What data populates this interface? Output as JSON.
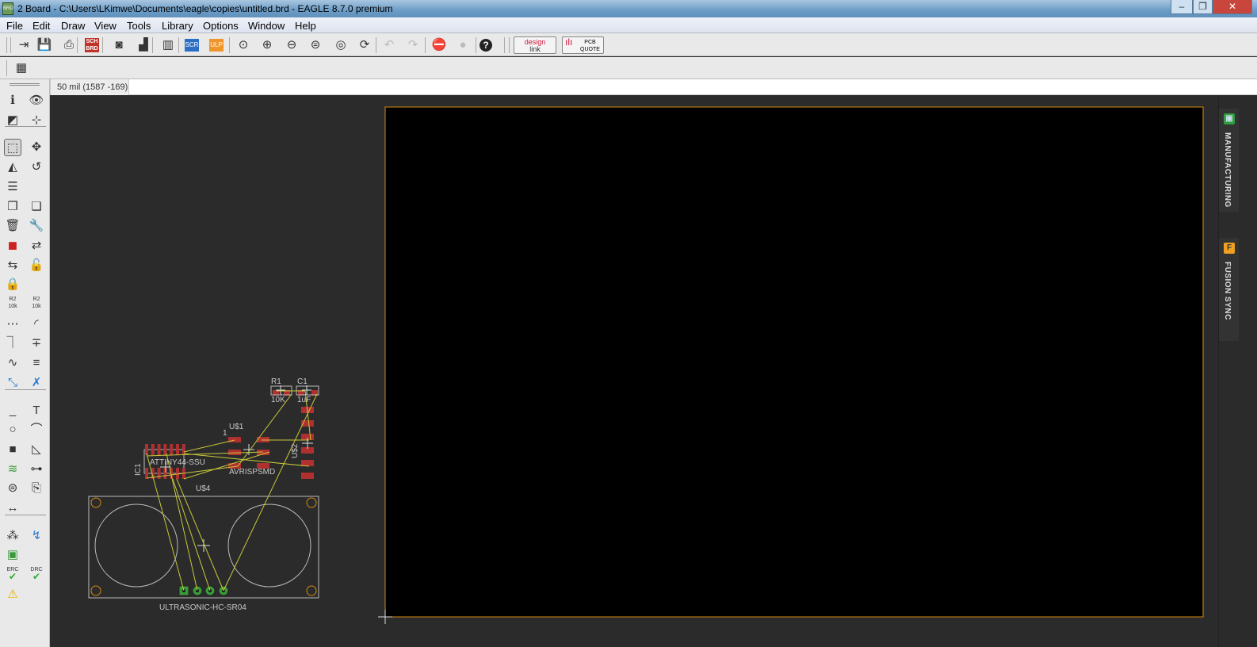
{
  "window": {
    "title": "2 Board - C:\\Users\\LKimwe\\Documents\\eagle\\copies\\untitled.brd - EAGLE 8.7.0 premium",
    "app_icon": "BRD",
    "minimize": "–",
    "restore": "❐",
    "close": "✕"
  },
  "menu": [
    "File",
    "Edit",
    "Draw",
    "View",
    "Tools",
    "Library",
    "Options",
    "Window",
    "Help"
  ],
  "toolbar": {
    "icons": [
      "open-icon",
      "save-icon",
      "print-icon",
      "sch-brd-switch-icon",
      "cam-processor-icon",
      "manufacturing-icon",
      "library-icon",
      "script-icon",
      "ulp-icon",
      "zoom-fit-icon",
      "zoom-in-icon",
      "zoom-out-icon",
      "zoom-select-icon",
      "zoom-area-icon",
      "redraw-icon",
      "undo-icon",
      "redo-icon",
      "stop-icon",
      "go-icon",
      "help-icon"
    ],
    "sch_brd": "SCH BRD",
    "scr": "SCR",
    "ulp": "ULP",
    "designlink": {
      "line1": "design",
      "line2": "link"
    },
    "pcb_quote": {
      "line1": "PCB",
      "line2": "QUOTE"
    }
  },
  "status": {
    "coordinate": "50 mil (1587 -169)",
    "command": ""
  },
  "left_toolbar": [
    [
      "info-icon",
      "show-icon"
    ],
    [
      "layer-settings-icon",
      "mark-icon"
    ],
    null,
    [
      "select-icon",
      "move-icon"
    ],
    [
      "mirror-icon",
      "rotate-icon"
    ],
    [
      "align-icon",
      ""
    ],
    [
      "copy-icon",
      "paste-icon"
    ],
    [
      "delete-icon",
      "change-icon"
    ],
    [
      "add-icon",
      "replace-icon"
    ],
    [
      "swap-icon",
      "lock-part-icon"
    ],
    [
      "lock-icon",
      ""
    ],
    [
      "name-icon",
      "value-icon"
    ],
    [
      "smash-icon",
      "miter-icon"
    ],
    [
      "split-icon",
      "optimize-icon"
    ],
    [
      "meander-icon",
      "route-multiple-icon"
    ],
    [
      "route-icon",
      "ripup-icon"
    ],
    null,
    [
      "line-icon",
      "text-icon"
    ],
    [
      "circle-icon",
      "arc-icon"
    ],
    [
      "rectangle-icon",
      "polygon-icon"
    ],
    [
      "via-icon",
      "signal-icon"
    ],
    [
      "hole-icon",
      "attribute-icon"
    ],
    [
      "dimension-icon",
      ""
    ],
    null,
    [
      "ratsnest-icon",
      "autorouter-icon"
    ],
    [
      "design-block-icon",
      ""
    ],
    [
      "erc-icon",
      "drc-icon"
    ],
    [
      "errors-icon",
      ""
    ]
  ],
  "left_labels": {
    "name": "R2",
    "value": "10k",
    "erc": "ERC",
    "drc": "DRC"
  },
  "right_panel": [
    {
      "label": "MANUFACTURING",
      "icon": "manufacturing-panel-icon",
      "letter": "▣",
      "color": "#2e9e3e"
    },
    {
      "label": "FUSION SYNC",
      "icon": "fusion-sync-icon",
      "letter": "F",
      "color": "#f0a020"
    }
  ],
  "board": {
    "components": {
      "r1": "R1",
      "r1_value": "10K",
      "c1": "C1",
      "c1_value": "1uF",
      "us1": "U$1",
      "us1_pin": "1",
      "avr": "AVRISPSMD",
      "ic1": "IC1",
      "ic1_value": "ATTINY44-SSU",
      "us2": "U$2",
      "us4": "U$4",
      "sonar": "ULTRASONIC-HC-SR04"
    },
    "colors": {
      "pad": "#b03030",
      "airwire": "#c8c83a",
      "outline": "#c0c0c0",
      "board_edge": "#d68a10",
      "via_pad": "#3a9a3a"
    }
  }
}
